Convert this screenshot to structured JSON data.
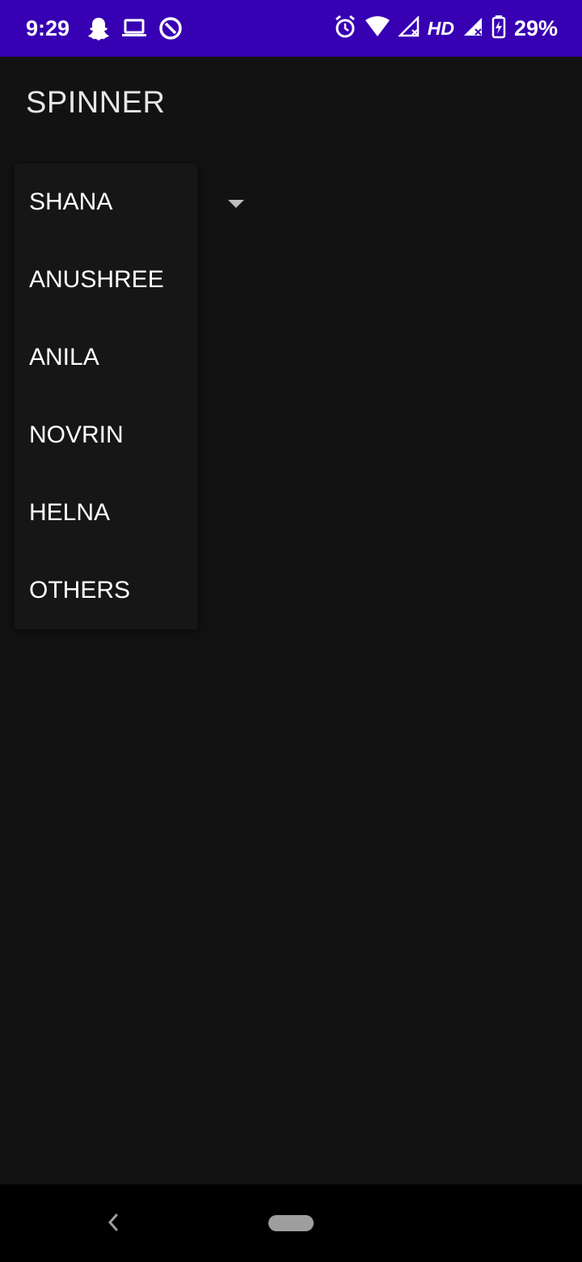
{
  "status_bar": {
    "time": "9:29",
    "left_icons": [
      "snapchat-icon",
      "laptop-icon",
      "data-saver-icon"
    ],
    "right_icons": [
      "alarm-icon",
      "wifi-icon",
      "signal-icon",
      "signal-icon",
      "battery-charging-icon"
    ],
    "network_label": "HD",
    "battery_text": "29%",
    "bg_color": "#3700b3"
  },
  "app": {
    "title": "SPINNER"
  },
  "spinner": {
    "selected": "SHANA",
    "options": [
      "SHANA",
      "ANUSHREE",
      "ANILA",
      "NOVRIN",
      "HELNA",
      "OTHERS"
    ]
  },
  "nav_bar": {
    "icons": [
      "back-icon",
      "home-pill-icon"
    ]
  }
}
